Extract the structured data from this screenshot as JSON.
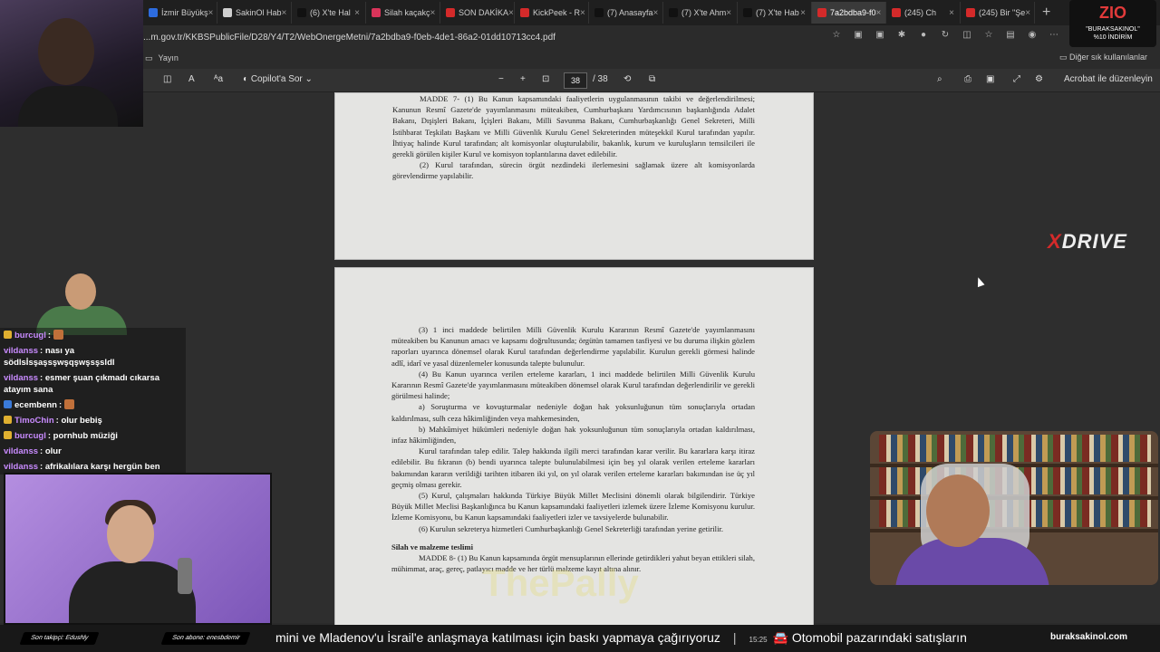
{
  "browser": {
    "tabs": [
      {
        "label": "İzmir Büyükş",
        "color": "#2d6cdf"
      },
      {
        "label": "SakinOl Hab",
        "color": "#cfcfcf"
      },
      {
        "label": "(6) X'te Hal",
        "color": "#111111"
      },
      {
        "label": "Silah kaçakç",
        "color": "#d9345a"
      },
      {
        "label": "SON DAKİKA",
        "color": "#d42a2a"
      },
      {
        "label": "KickPeek - R",
        "color": "#d42a2a"
      },
      {
        "label": "(7) Anasayfa",
        "color": "#111111"
      },
      {
        "label": "(7) X'te Ahm",
        "color": "#111111"
      },
      {
        "label": "(7) X'te Hab",
        "color": "#111111"
      },
      {
        "label": "7a2bdba9-f0",
        "color": "#d42a2a"
      },
      {
        "label": "(245) Ch",
        "color": "#d42a2a"
      },
      {
        "label": "(245) Bir \"Şe",
        "color": "#d42a2a"
      }
    ],
    "active_tab": 9,
    "url": "...m.gov.tr/KKBSPublicFile/D28/Y4/T2/WebOnergeMetni/7a2bdba9-f0eb-4de1-86a2-01dd10713cc4.pdf",
    "bookmark": "Yayın",
    "other_bookmarks": "Diğer sık kullanılanlar"
  },
  "pdf": {
    "copilot": "Copilot'a Sor",
    "page_current": "38",
    "page_total": "/ 38",
    "acrobat": "Acrobat ile düzenleyin",
    "page1": [
      "MADDE 7- (1) Bu Kanun kapsamındaki faaliyetlerin uygulanmasının takibi ve değerlendirilmesi; Kanunun Resmî Gazete'de yayımlanmasını müteakiben, Cumhurbaşkanı Yardımcısının başkanlığında Adalet Bakanı, Dışişleri Bakanı, İçişleri Bakanı, Milli Savunma Bakanı, Cumhurbaşkanlığı Genel Sekreteri, Milli İstihbarat Teşkilatı Başkanı ve Milli Güvenlik Kurulu Genel Sekreterinden müteşekkil Kurul tarafından yapılır. İhtiyaç halinde Kurul tarafından; alt komisyonlar oluşturulabilir, bakanlık, kurum ve kuruluşların temsilcileri ile gerekli görülen kişiler Kurul ve komisyon toplantılarına davet edilebilir.",
      "(2) Kurul tarafından, sürecin örgüt nezdindeki ilerlemesini sağlamak üzere alt komisyonlarda görevlendirme yapılabilir."
    ],
    "page2": [
      "(3) 1 inci maddede belirtilen Milli Güvenlik Kurulu Kararının Resmî Gazete'de yayımlanmasını müteakiben bu Kanunun amacı ve kapsamı doğrultusunda; örgütün tamamen tasfiyesi ve bu duruma ilişkin gözlem raporları uyarınca dönemsel olarak Kurul tarafından değerlendirme yapılabilir. Kurulun gerekli görmesi halinde adlî, idarî ve yasal düzenlemeler konusunda talepte bulunulur.",
      "(4) Bu Kanun uyarınca verilen erteleme kararları, 1 inci maddede belirtilen Milli Güvenlik Kurulu Kararının Resmî Gazete'de yayımlanmasını müteakiben dönemsel olarak Kurul tarafından değerlendirilir ve gerekli görülmesi halinde;",
      "a) Soruşturma ve kovuşturmalar nedeniyle doğan hak yoksunluğunun tüm sonuçlarıyla ortadan kaldırılması, sulh ceza hâkimliğinden veya mahkemesinden,",
      "b) Mahkûmiyet hükümleri nedeniyle doğan hak yoksunluğunun tüm sonuçlarıyla ortadan kaldırılması, infaz hâkimliğinden,",
      "Kurul tarafından talep edilir. Talep hakkında ilgili merci tarafından karar verilir. Bu kararlara karşı itiraz edilebilir. Bu fıkranın (b) bendi uyarınca talepte bulunulabilmesi için beş yıl olarak verilen erteleme kararları bakımından kararın verildiği tarihten itibaren iki yıl, on yıl olarak verilen erteleme kararları bakımından ise üç yıl geçmiş olması gerekir.",
      "(5) Kurul, çalışmaları hakkında Türkiye Büyük Millet Meclisini dönemli olarak bilgilendirir. Türkiye Büyük Millet Meclisi Başkanlığınca bu Kanun kapsamındaki faaliyetleri izlemek üzere İzleme Komisyonu kurulur. İzleme Komisyonu, bu Kanun kapsamındaki faaliyetleri izler ve tavsiyelerde bulunabilir.",
      "(6) Kurulun sekreterya hizmetleri Cumhurbaşkanlığı Genel Sekreterliği tarafından yerine getirilir.",
      "Silah ve malzeme teslimi",
      "MADDE 8- (1) Bu Kanun kapsamında örgüt mensuplarının ellerinde getirdikleri yahut beyan ettikleri silah, mühimmat, araç, gereç, patlayıcı madde ve her türlü malzeme kayıt altına alınır."
    ]
  },
  "overlay": {
    "brand_top": "ZIO",
    "brand_top_sub1": "\"BURAKSAKINOL\"",
    "brand_top_sub2": "%10 İNDİRİM",
    "sponsor_x": "X",
    "sponsor_rest": "DRIVE",
    "watermark": "ThePally"
  },
  "chat": [
    {
      "user": "burcugl",
      "text": ": ",
      "user_color": "#c98bff",
      "badge": "#e0b030",
      "emote": true
    },
    {
      "user": "vildanss",
      "text": ": nası ya södlsİsşaşsşwşqşwşsşsldl",
      "user_color": "#c98bff",
      "badge": "",
      "emote": false
    },
    {
      "user": "vildanss",
      "text": ": esmer şuan çıkmadı cıkarsa atayım sana",
      "user_color": "#c98bff",
      "badge": "",
      "emote": false
    },
    {
      "user": "ecembenn",
      "text": ": ",
      "user_color": "#ffffff",
      "badge": "#3a7ad9",
      "emote": true
    },
    {
      "user": "TimoChin",
      "text": ": olur bebiş",
      "user_color": "#c98bff",
      "badge": "#e0b030",
      "emote": false
    },
    {
      "user": "burcugl",
      "text": ": pornhub müziği",
      "user_color": "#c98bff",
      "badge": "#e0b030",
      "emote": false
    },
    {
      "user": "vildanss",
      "text": ": olur",
      "user_color": "#c98bff",
      "badge": "",
      "emote": false
    },
    {
      "user": "vildanss",
      "text": ": afrikalılara karşı hergün ben",
      "user_color": "#c98bff",
      "badge": "",
      "emote": false
    }
  ],
  "footer": {
    "follower": "Son takipçi: Edushly",
    "subscriber": "Son abone: enesbdemir",
    "ticker_left": "mini ve Mladenov'u İsrail'e anlaşmaya katılması için baskı yapmaya çağırıyoruz",
    "ticker_time": "15:25",
    "ticker_right": "🚘 Otomobil pazarındaki satışların",
    "site": "buraksakinol.com"
  }
}
